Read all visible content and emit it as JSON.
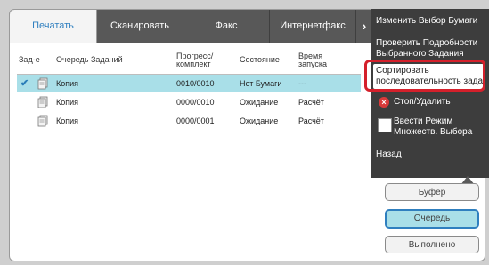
{
  "tabs": [
    {
      "label": "Печатать"
    },
    {
      "label": "Сканировать"
    },
    {
      "label": "Факс"
    },
    {
      "label": "Интернетфакс"
    }
  ],
  "tab_more_icon": "chevron-right-icon",
  "table": {
    "columns": {
      "job": "Зад-е",
      "queue": "Очередь Заданий",
      "progress_l1": "Прогресс/",
      "progress_l2": "комплект",
      "status": "Состояние",
      "time_l1": "Время",
      "time_l2": "запуска"
    },
    "rows": [
      {
        "name": "Копия",
        "progress": "0010/0010",
        "status": "Нет Бумаги",
        "time": "---"
      },
      {
        "name": "Копия",
        "progress": "0000/0010",
        "status": "Ожидание",
        "time": "Расчёт"
      },
      {
        "name": "Копия",
        "progress": "0000/0001",
        "status": "Ожидание",
        "time": "Расчёт"
      }
    ]
  },
  "menu": {
    "change_paper": "Изменить Выбор Бумаги",
    "check_details_l1": "Проверить Подробности",
    "check_details_l2": "Выбранного Задания",
    "sort_l1": "Сортировать",
    "sort_l2": "последовательность задания",
    "stop_delete": "Стоп/Удалить",
    "multi_l1": "Ввести Режим",
    "multi_l2": "Множеств. Выбора",
    "back": "Назад"
  },
  "buttons": {
    "buffer": "Буфер",
    "queue": "Очередь",
    "done": "Выполнено"
  },
  "colors": {
    "selected_row": "#a9dfe8",
    "accent": "#2f7fbf",
    "highlight_border": "#d4202b",
    "stop": "#d93a3a"
  }
}
